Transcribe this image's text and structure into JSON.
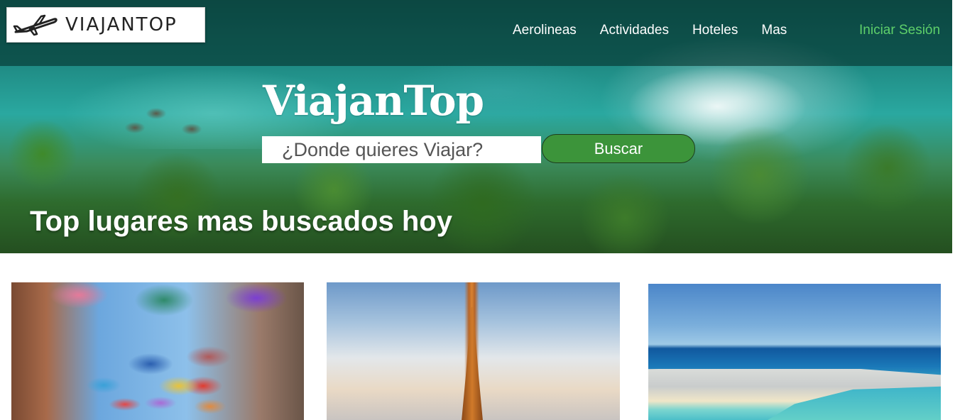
{
  "brand": {
    "logo_text": "VIAJANTOP",
    "hero_title": "ViajanTop"
  },
  "nav": {
    "items": [
      {
        "label": "Aerolineas"
      },
      {
        "label": "Actividades"
      },
      {
        "label": "Hoteles"
      },
      {
        "label": "Mas"
      }
    ],
    "login_label": "Iniciar Sesión"
  },
  "search": {
    "placeholder": "¿Donde quieres Viajar?",
    "button_label": "Buscar"
  },
  "section": {
    "title": "Top lugares mas buscados hoy"
  },
  "cards": [
    {
      "image": "colorful-umbrellas-street"
    },
    {
      "image": "eiffel-tower-paris"
    },
    {
      "image": "cancun-beach-hotels"
    }
  ],
  "colors": {
    "accent_green": "#3c943a",
    "login_green": "#5ed06a"
  },
  "icons": {
    "logo_icon": "airplane-icon"
  }
}
